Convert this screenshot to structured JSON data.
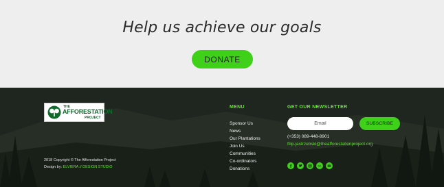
{
  "hero": {
    "title": "Help us achieve our goals",
    "donate_label": "DONATE"
  },
  "logo": {
    "line1": "THE",
    "line2": "AFFORESTATION",
    "line3": "PROJECT"
  },
  "footer": {
    "copyright": "2018 Copyright © The Afforestation Project",
    "design_prefix": "Design by:",
    "design_studio": "ELVIERA // DESIGN STUDIO"
  },
  "menu": {
    "heading": "MENU",
    "items": [
      "Sponsor Us",
      "News",
      "Our Plantations",
      "Join Us",
      "Communities",
      "Co-ordinators",
      "Donations"
    ]
  },
  "newsletter": {
    "heading": "GET OUR NEWSLETTER",
    "email_placeholder": "Email",
    "subscribe_label": "SUBSCRIBE",
    "phone": "(+353) 089-448-8901",
    "email": "filip.jastrzebski@theafforestationproject.org"
  },
  "social_icons": [
    "facebook-icon",
    "twitter-icon",
    "instagram-icon",
    "google-plus-icon",
    "email-icon"
  ],
  "colors": {
    "accent": "#3fd11a",
    "accent_text": "#5ee52a",
    "footer_bg": "#1d231d",
    "hero_bg": "#eeeeee"
  }
}
